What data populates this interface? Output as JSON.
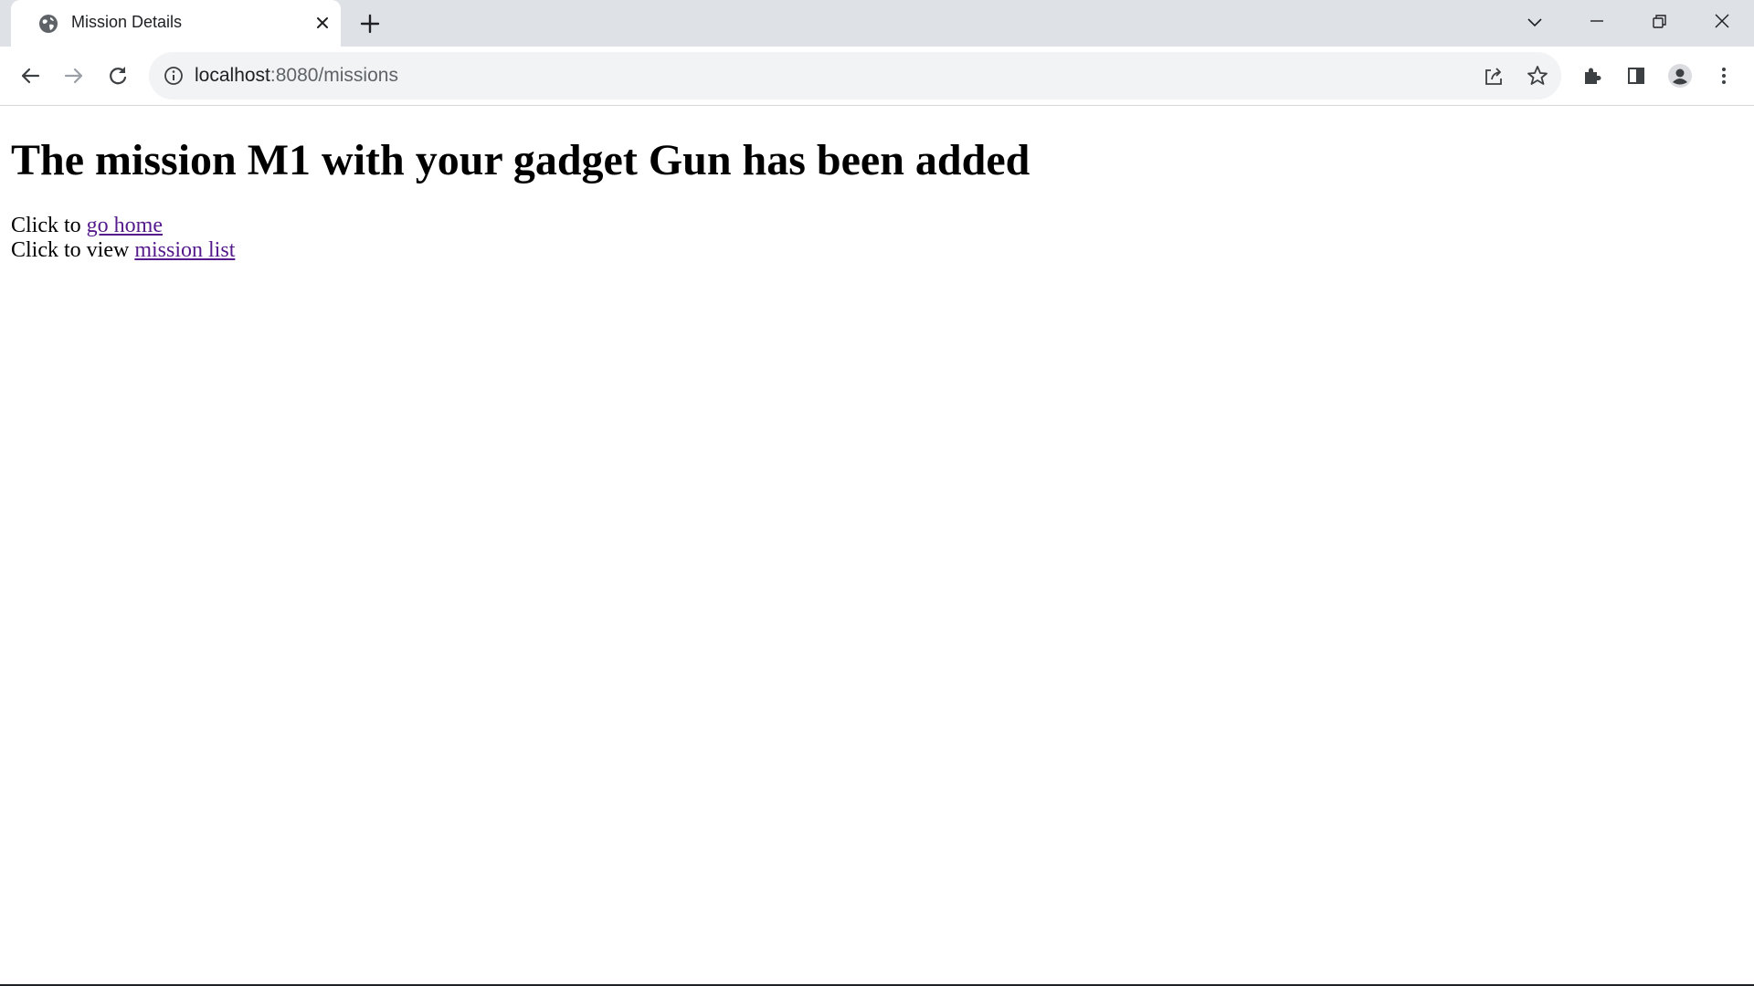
{
  "tab": {
    "title": "Mission Details",
    "favicon": "globe-icon"
  },
  "address_bar": {
    "host": "localhost",
    "rest": ":8080/missions"
  },
  "page": {
    "heading": "The mission M1 with your gadget Gun has been added",
    "line1_prefix": "Click to ",
    "line1_link": "go home",
    "line2_prefix": "Click to view ",
    "line2_link": "mission list"
  },
  "colors": {
    "tabstrip_bg": "#dee1e6",
    "omnibox_bg": "#f1f3f4",
    "visited_link": "#551a8b",
    "icon": "#5f6368"
  }
}
